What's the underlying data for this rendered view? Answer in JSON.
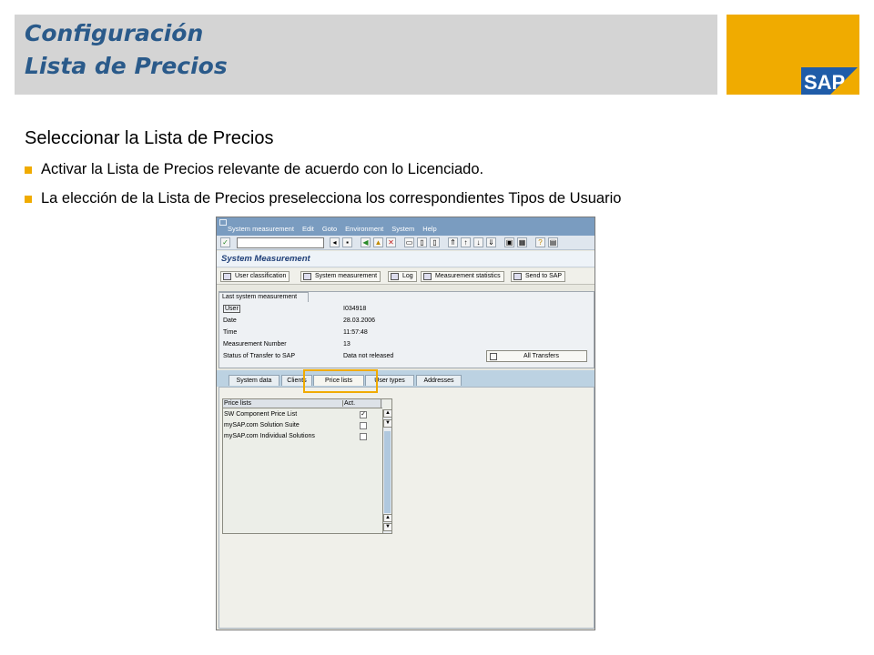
{
  "slide": {
    "title_line1": "Configuración",
    "title_line2": "Lista de Precios",
    "logo_text": "SAP",
    "subtitle": "Seleccionar la Lista de Precios",
    "bullets": [
      "Activar la Lista de Precios relevante de acuerdo con lo Licenciado.",
      "La elección de la Lista de Precios preselecciona los correspondientes Tipos de Usuario"
    ],
    "accent_color": "#f0ab00",
    "title_color": "#2a5a8a"
  },
  "sap_window": {
    "menu": [
      "System measurement",
      "Edit",
      "Goto",
      "Environment",
      "System",
      "Help"
    ],
    "page_title": "System Measurement",
    "toolbar_buttons": [
      "User classification",
      "System measurement",
      "Log",
      "Measurement statistics",
      "Send to SAP"
    ],
    "group_title": "Last system measurement",
    "fields": [
      {
        "label": "User",
        "value": "I034918"
      },
      {
        "label": "Date",
        "value": "28.03.2006"
      },
      {
        "label": "Time",
        "value": "11:57:48"
      },
      {
        "label": "Measurement Number",
        "value": "13"
      },
      {
        "label": "Status of Transfer to SAP",
        "value": "Data not released"
      }
    ],
    "all_transfers_label": "All Transfers",
    "tabs": [
      "System data",
      "Clients",
      "Price lists",
      "User types",
      "Addresses"
    ],
    "active_tab": "Price lists",
    "table": {
      "headers": [
        "Price lists",
        "Act."
      ],
      "rows": [
        {
          "name": "SW Component Price List",
          "active": true,
          "mark": "✓"
        },
        {
          "name": "mySAP.com Solution Suite",
          "active": false,
          "mark": ""
        },
        {
          "name": "mySAP.com Individual Solutions",
          "active": false,
          "mark": ""
        }
      ]
    }
  }
}
